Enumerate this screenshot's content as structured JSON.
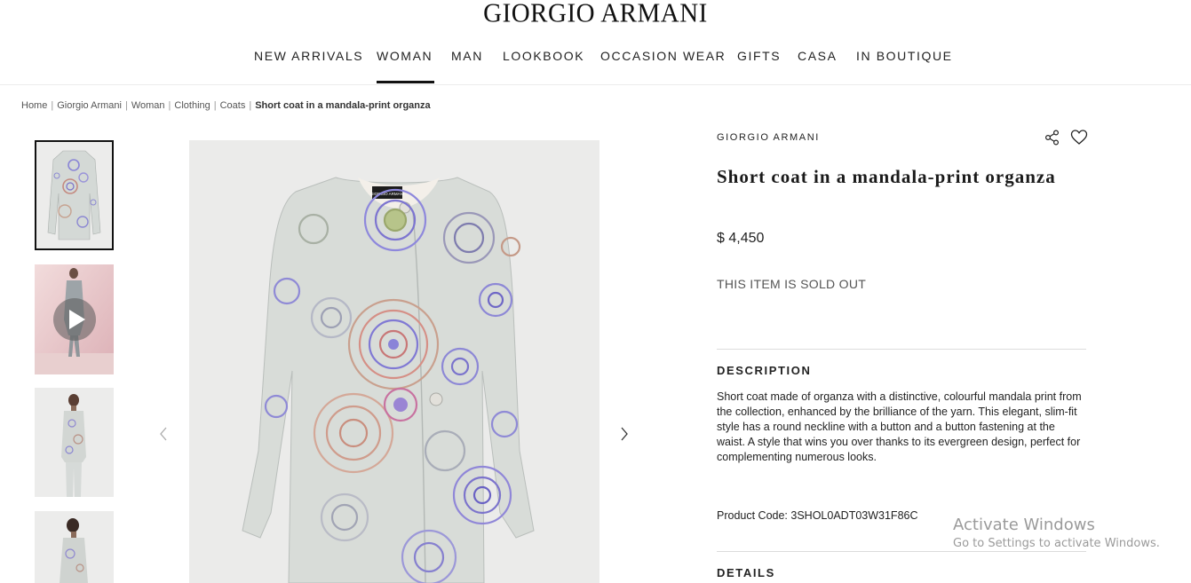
{
  "header": {
    "logo": "GIORGIO ARMANI",
    "nav": [
      {
        "label": "NEW ARRIVALS"
      },
      {
        "label": "WOMAN",
        "active": true
      },
      {
        "label": "MAN"
      },
      {
        "label": "LOOKBOOK"
      },
      {
        "label": "OCCASION WEAR"
      },
      {
        "label": "GIFTS"
      },
      {
        "label": "CASA"
      },
      {
        "label": "IN BOUTIQUE"
      }
    ]
  },
  "breadcrumb": {
    "items": [
      "Home",
      "Giorgio Armani",
      "Woman",
      "Clothing",
      "Coats"
    ],
    "separator": "|",
    "current": "Short coat in a mandala-print organza"
  },
  "gallery": {
    "thumbnails": [
      {
        "type": "image",
        "icon": "coat-flat-image",
        "selected": true
      },
      {
        "type": "video",
        "icon": "play-icon"
      },
      {
        "type": "image",
        "icon": "model-front-image"
      },
      {
        "type": "image",
        "icon": "model-side-image"
      }
    ],
    "main_icon": "coat-flat-image",
    "prev_icon": "chevron-left-icon",
    "next_icon": "chevron-right-icon",
    "label_text": "GIORGIO ARMANI"
  },
  "product": {
    "brand": "GIORGIO ARMANI",
    "title": "Short coat in a mandala-print organza",
    "price": "$ 4,450",
    "availability": "THIS ITEM IS SOLD OUT",
    "share_icon": "share-icon",
    "wishlist_icon": "heart-icon",
    "description_heading": "DESCRIPTION",
    "description": "Short coat made of organza with a distinctive, colourful mandala print from the collection, enhanced by the brilliance of the yarn. This elegant, slim-fit style has a round neckline with a button and a button fastening at the waist. A style that wins you over thanks to its evergreen design, perfect for complementing numerous looks.",
    "product_code": "Product Code: 3SHOL0ADT03W31F86C",
    "details_heading": "DETAILS"
  },
  "watermark": {
    "title": "Activate Windows",
    "subtitle": "Go to Settings to activate Windows."
  },
  "colors": {
    "text": "#1a1a1a",
    "muted": "#555555",
    "rule": "#dcdcdc",
    "image_bg": "#ebebea"
  }
}
